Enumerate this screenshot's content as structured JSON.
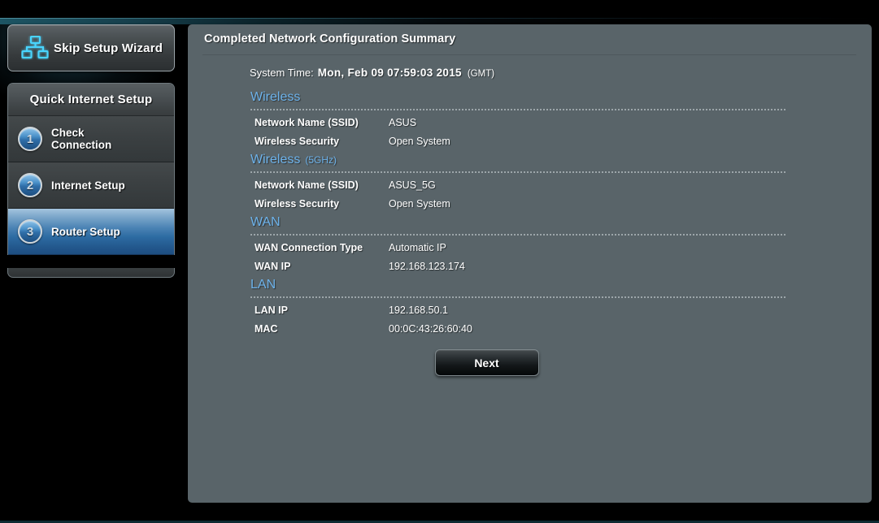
{
  "sidebar": {
    "skip_button": {
      "label": "Skip Setup Wizard",
      "icon": "network-topology-icon"
    },
    "qis_header": "Quick Internet Setup",
    "steps": [
      {
        "number": "1",
        "label": "Check\nConnection",
        "active": false
      },
      {
        "number": "2",
        "label": "Internet Setup",
        "active": false
      },
      {
        "number": "3",
        "label": "Router Setup",
        "active": true
      }
    ]
  },
  "main": {
    "title": "Completed Network Configuration Summary",
    "system_time": {
      "label": "System Time:",
      "value": "Mon, Feb 09 07:59:03 2015",
      "zone": "(GMT)"
    },
    "sections": [
      {
        "heading": "Wireless",
        "subheading": "",
        "rows": [
          {
            "key": "Network Name (SSID)",
            "value": "ASUS"
          },
          {
            "key": "Wireless Security",
            "value": "Open System"
          }
        ]
      },
      {
        "heading": "Wireless",
        "subheading": "(5GHz)",
        "rows": [
          {
            "key": "Network Name (SSID)",
            "value": "ASUS_5G"
          },
          {
            "key": "Wireless Security",
            "value": "Open System"
          }
        ]
      },
      {
        "heading": "WAN",
        "subheading": "",
        "rows": [
          {
            "key": "WAN Connection Type",
            "value": "Automatic IP"
          },
          {
            "key": "WAN IP",
            "value": "192.168.123.174"
          }
        ]
      },
      {
        "heading": "LAN",
        "subheading": "",
        "rows": [
          {
            "key": "LAN IP",
            "value": "192.168.50.1"
          },
          {
            "key": "MAC",
            "value": "00:0C:43:26:60:40"
          }
        ]
      }
    ],
    "next_button": "Next"
  },
  "colors": {
    "panel_background": "#596469",
    "section_heading": "#6db2ea",
    "active_step": "#2d6ba2",
    "accent_icon_glow": "#49d5ff",
    "text_primary": "#ffffff"
  }
}
